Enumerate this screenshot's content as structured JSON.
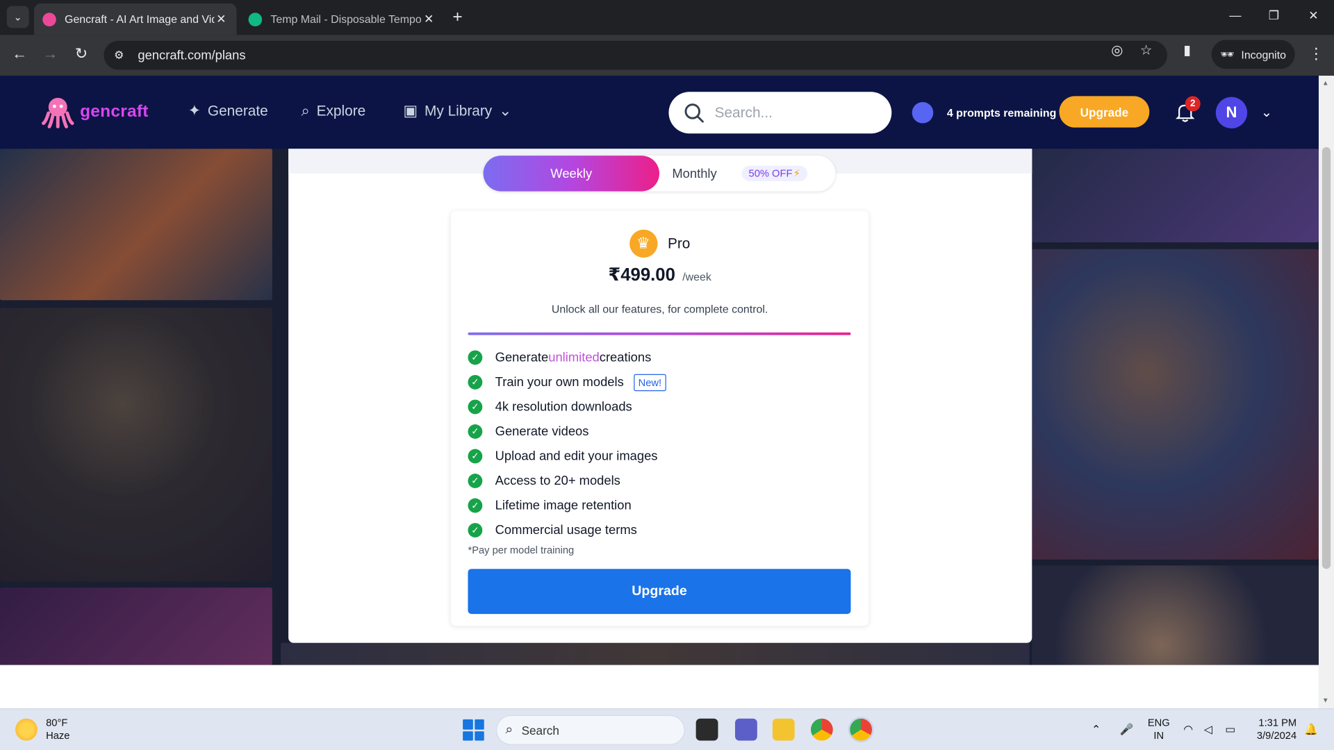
{
  "browser": {
    "tabs": [
      {
        "title": "Gencraft - AI Art Image and Video",
        "active": true
      },
      {
        "title": "Temp Mail - Disposable Temporary",
        "active": false
      }
    ],
    "url": "gencraft.com/plans",
    "incognito_label": "Incognito"
  },
  "site": {
    "logo_text": "gencraft",
    "nav": [
      {
        "label": "Generate",
        "icon": "sparkle-icon"
      },
      {
        "label": "Explore",
        "icon": "search-icon"
      },
      {
        "label": "My Library",
        "icon": "image-icon"
      }
    ],
    "search_placeholder": "Search...",
    "prompts_remaining": "4 prompts remaining",
    "upgrade_label": "Upgrade",
    "notification_count": "2",
    "avatar_initial": "N"
  },
  "plans": {
    "toggle": {
      "weekly": "Weekly",
      "monthly": "Monthly",
      "discount_badge": "50% OFF",
      "selected": "weekly"
    },
    "card": {
      "name": "Pro",
      "price": "₹499.00",
      "period": "/week",
      "tagline": "Unlock all our features, for complete control.",
      "features": [
        {
          "pre": "Generate ",
          "highlight": "unlimited",
          "post": " creations"
        },
        {
          "pre": "Train your own models",
          "badge": "New!"
        },
        {
          "pre": "4k resolution downloads"
        },
        {
          "pre": "Generate videos"
        },
        {
          "pre": "Upload and edit your images"
        },
        {
          "pre": "Access to 20+ models"
        },
        {
          "pre": "Lifetime image retention"
        },
        {
          "pre": "Commercial usage terms"
        }
      ],
      "footnote": "*Pay per model training",
      "cta": "Upgrade"
    }
  },
  "taskbar": {
    "weather_temp": "80°F",
    "weather_desc": "Haze",
    "search_label": "Search",
    "lang_1": "ENG",
    "lang_2": "IN",
    "time": "1:31 PM",
    "date": "3/9/2024"
  },
  "colors": {
    "header_bg": "#0c1445",
    "accent_gradient_start": "#7c6cf0",
    "accent_gradient_end": "#ec1f8a",
    "upgrade_orange": "#f8a825",
    "cta_blue": "#1a73e8",
    "check_green": "#16a34a"
  }
}
